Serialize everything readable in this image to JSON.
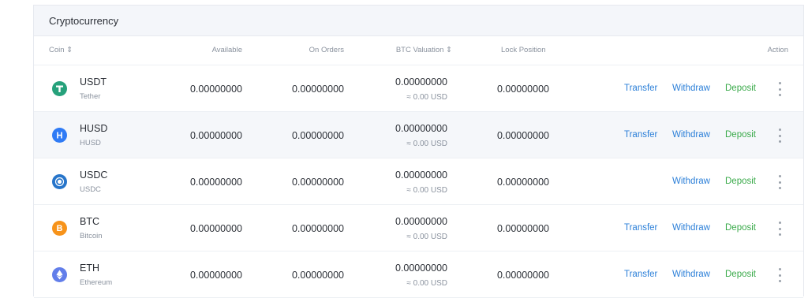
{
  "panel": {
    "title": "Cryptocurrency"
  },
  "columns": {
    "coin": "Coin ⇕",
    "available": "Available",
    "on_orders": "On Orders",
    "btc_valuation": "BTC Valuation ⇕",
    "lock_position": "Lock Position",
    "action": "Action"
  },
  "actions": {
    "transfer": "Transfer",
    "withdraw": "Withdraw",
    "deposit": "Deposit"
  },
  "rows": [
    {
      "symbol": "USDT",
      "name": "Tether",
      "available": "0.00000000",
      "on_orders": "0.00000000",
      "btc_valuation": "0.00000000",
      "usd_value": "≈ 0.00 USD",
      "lock_position": "0.00000000",
      "icon": "tether-icon",
      "color": "#26a17b"
    },
    {
      "symbol": "HUSD",
      "name": "HUSD",
      "available": "0.00000000",
      "on_orders": "0.00000000",
      "btc_valuation": "0.00000000",
      "usd_value": "≈ 0.00 USD",
      "lock_position": "0.00000000",
      "icon": "husd-icon",
      "color": "#2f7bf5"
    },
    {
      "symbol": "USDC",
      "name": "USDC",
      "available": "0.00000000",
      "on_orders": "0.00000000",
      "btc_valuation": "0.00000000",
      "usd_value": "≈ 0.00 USD",
      "lock_position": "0.00000000",
      "icon": "usdc-icon",
      "color": "#2775ca"
    },
    {
      "symbol": "BTC",
      "name": "Bitcoin",
      "available": "0.00000000",
      "on_orders": "0.00000000",
      "btc_valuation": "0.00000000",
      "usd_value": "≈ 0.00 USD",
      "lock_position": "0.00000000",
      "icon": "bitcoin-icon",
      "color": "#f7931a"
    },
    {
      "symbol": "ETH",
      "name": "Ethereum",
      "available": "0.00000000",
      "on_orders": "0.00000000",
      "btc_valuation": "0.00000000",
      "usd_value": "≈ 0.00 USD",
      "lock_position": "0.00000000",
      "icon": "ethereum-icon",
      "color": "#627eea"
    }
  ]
}
